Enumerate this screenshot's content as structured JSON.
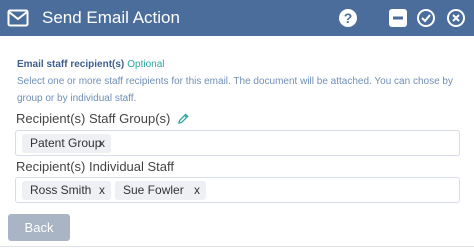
{
  "window": {
    "title": "Send Email Action",
    "icons": [
      "mail-icon",
      "help-icon",
      "minimize-icon",
      "confirm-icon",
      "cancel-icon"
    ]
  },
  "colors": {
    "titlebar": "#4a6d9b",
    "optional": "#2aa7a0",
    "description": "#6f8fb6",
    "button": "#a9b5c4"
  },
  "section": {
    "title": "Email staff recipient(s)",
    "optional": "Optional",
    "description": "Select one or more staff recipients for this email. The document will be attached. You can chose by group or by individual staff."
  },
  "groups": {
    "label": "Recipient(s) Staff Group(s)",
    "tags": [
      {
        "label": "Patent Group",
        "remove": "x"
      }
    ]
  },
  "staff": {
    "label": "Recipient(s) Individual Staff",
    "tags": [
      {
        "label": "Ross Smith",
        "remove": "x"
      },
      {
        "label": "Sue Fowler",
        "remove": "x"
      }
    ]
  },
  "footer": {
    "back_label": "Back"
  }
}
